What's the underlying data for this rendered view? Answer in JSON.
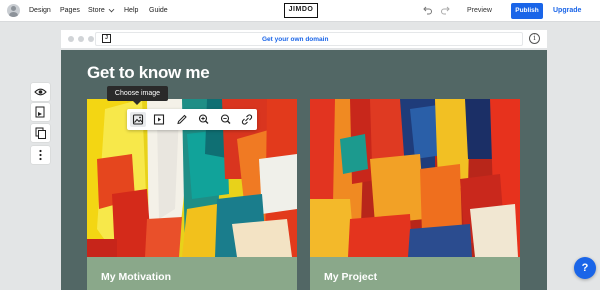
{
  "topbar": {
    "nav": [
      "Design",
      "Pages",
      "Store",
      "Help",
      "Guide"
    ],
    "logo": "JIMDO",
    "preview_label": "Preview",
    "publish_label": "Publish",
    "upgrade_label": "Upgrade"
  },
  "browser": {
    "mini_logo": "J",
    "domain_cta": "Get your own domain",
    "info_glyph": "i"
  },
  "section": {
    "title": "Get to know me"
  },
  "tooltip": {
    "label": "Choose image"
  },
  "cards": [
    {
      "title": "My Motivation"
    },
    {
      "title": "My Project"
    }
  ],
  "help": {
    "glyph": "?"
  },
  "colors": {
    "accent": "#1a65e8",
    "site_background": "#526765",
    "card_footer": "#8aa88a",
    "tooltip_bg": "#2a2a2a"
  },
  "icons": {
    "rail": [
      "eye-icon",
      "layers-icon",
      "copy-icon",
      "more-vertical-icon"
    ],
    "image_toolbar": [
      "image-icon",
      "video-icon",
      "pencil-icon",
      "zoom-in-icon",
      "zoom-out-icon",
      "link-icon"
    ]
  }
}
